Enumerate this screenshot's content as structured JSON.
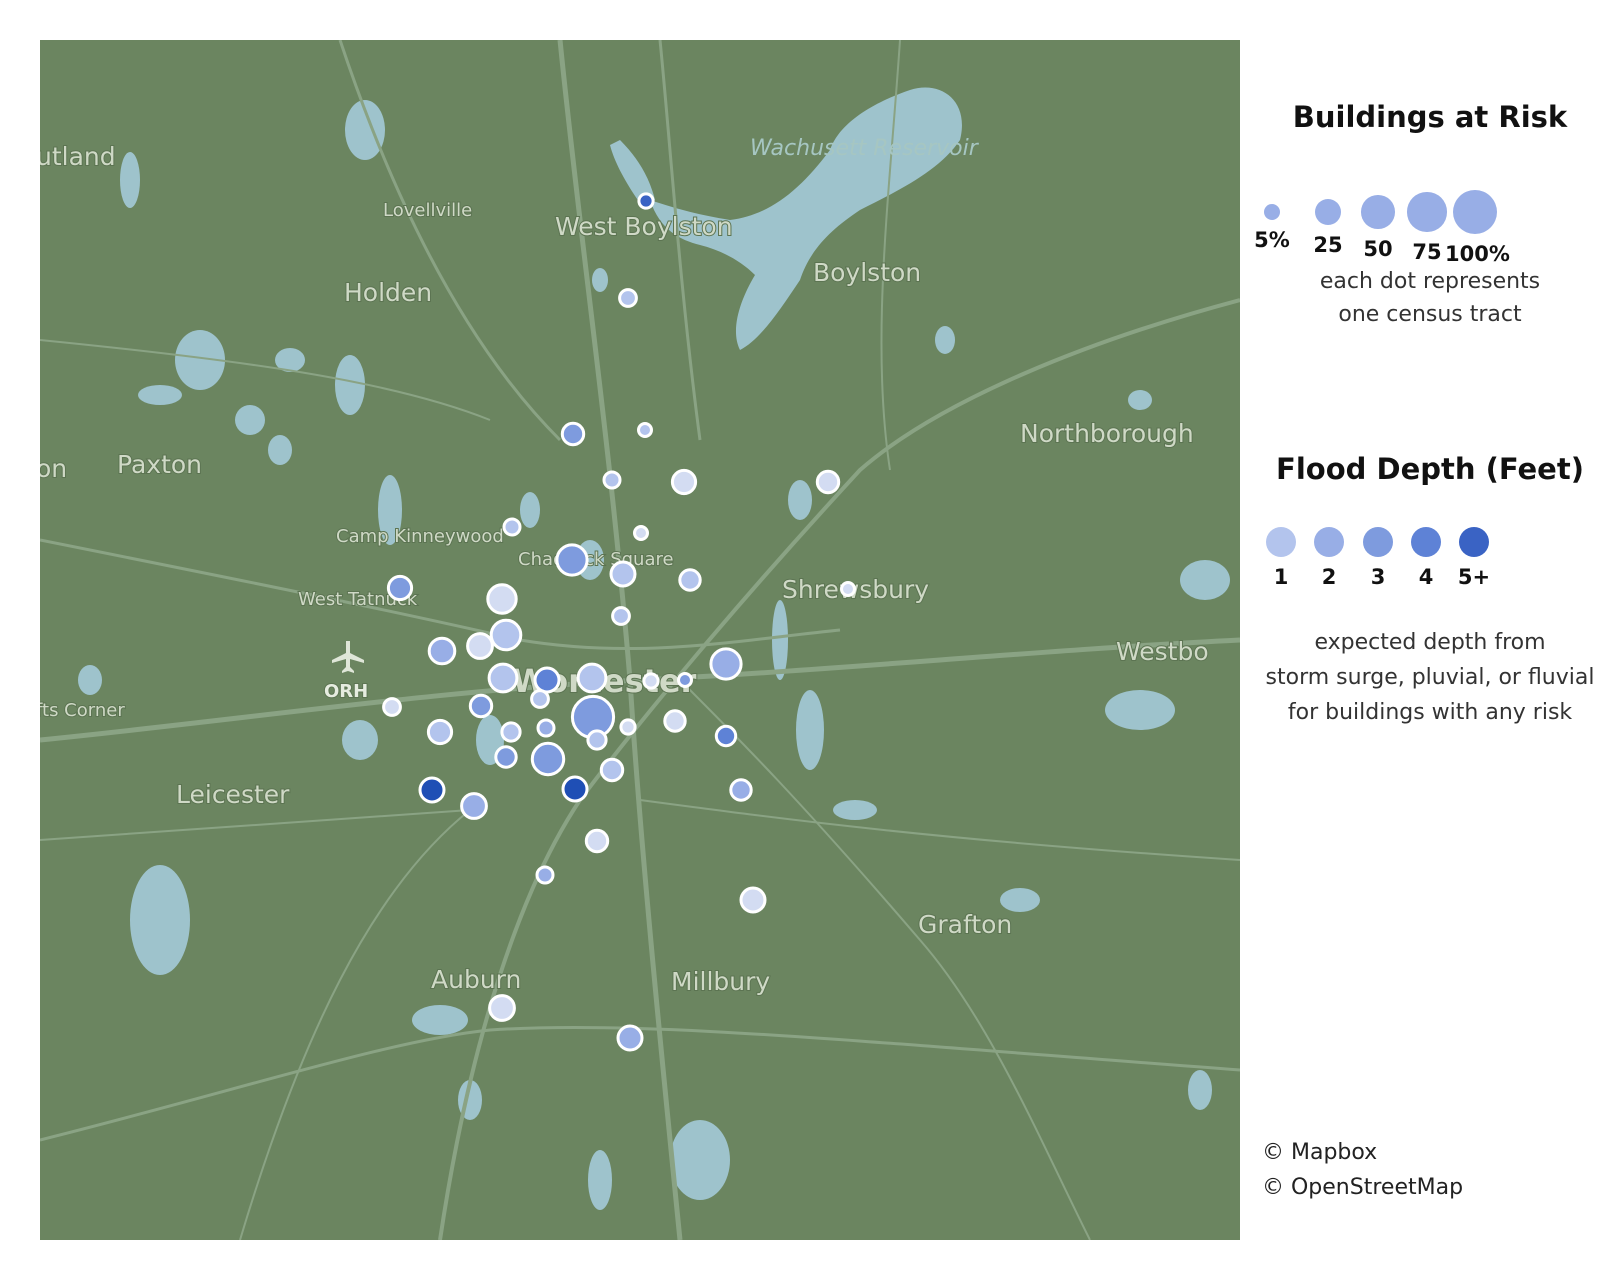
{
  "map": {
    "places": [
      {
        "name": "Rutland",
        "display": "utland",
        "size": "lg"
      },
      {
        "name": "Lovellville",
        "size": "sm"
      },
      {
        "name": "West Boylston",
        "size": "lg"
      },
      {
        "name": "Holden",
        "size": "lg"
      },
      {
        "name": "Boylston",
        "size": "lg"
      },
      {
        "name": "Paxton",
        "size": "lg"
      },
      {
        "name": "Northborough",
        "size": "lg"
      },
      {
        "name": "Camp Kinneywood",
        "size": "sm"
      },
      {
        "name": "Chadwick Square",
        "size": "sm"
      },
      {
        "name": "West Tatnuck",
        "size": "sm"
      },
      {
        "name": "Shrewsbury",
        "size": "lg"
      },
      {
        "name": "Westborough",
        "display": "Westbo",
        "size": "lg"
      },
      {
        "name": "ORH",
        "size": "airport"
      },
      {
        "name": "Worcester",
        "size": "city"
      },
      {
        "name": "Tufts Corner",
        "display": "fts Corner",
        "size": "sm"
      },
      {
        "name": "Leicester",
        "size": "lg"
      },
      {
        "name": "Grafton",
        "size": "lg"
      },
      {
        "name": "Auburn",
        "size": "lg"
      },
      {
        "name": "Millbury",
        "size": "lg"
      },
      {
        "name": "Spencer",
        "display": "on",
        "size": "lg"
      }
    ],
    "water_label": "Wachusett Reservoir",
    "colors": {
      "land": "#6b8560",
      "water": "#9ec3cc",
      "roads": "#8aa384",
      "dot_outline": "#ffffff",
      "depth_1": "#b3c4ed",
      "depth_2": "#98aee6",
      "depth_3": "#7e9bde",
      "depth_4": "#5e82d6",
      "depth_5_plus": "#3a63c4"
    },
    "tracts": [
      {
        "risk_pct": 3,
        "depth": 5
      },
      {
        "risk_pct": 6,
        "depth": 1
      },
      {
        "risk_pct": 14,
        "depth": 3
      },
      {
        "risk_pct": 2,
        "depth": 1
      },
      {
        "risk_pct": 5,
        "depth": 1
      },
      {
        "risk_pct": 18,
        "depth": 0
      },
      {
        "risk_pct": 14,
        "depth": 0
      },
      {
        "risk_pct": 5,
        "depth": 1
      },
      {
        "risk_pct": 2,
        "depth": 0
      },
      {
        "risk_pct": 38,
        "depth": 3
      },
      {
        "risk_pct": 20,
        "depth": 1
      },
      {
        "risk_pct": 12,
        "depth": 1
      },
      {
        "risk_pct": 2,
        "depth": 0
      },
      {
        "risk_pct": 18,
        "depth": 3
      },
      {
        "risk_pct": 32,
        "depth": 0
      },
      {
        "risk_pct": 6,
        "depth": 1
      },
      {
        "risk_pct": 36,
        "depth": 1
      },
      {
        "risk_pct": 22,
        "depth": 0
      },
      {
        "risk_pct": 24,
        "depth": 2
      },
      {
        "risk_pct": 38,
        "depth": 2
      },
      {
        "risk_pct": 30,
        "depth": 1
      },
      {
        "risk_pct": 30,
        "depth": 1
      },
      {
        "risk_pct": 3,
        "depth": 0
      },
      {
        "risk_pct": 2,
        "depth": 3
      },
      {
        "risk_pct": 20,
        "depth": 4
      },
      {
        "risk_pct": 6,
        "depth": 0
      },
      {
        "risk_pct": 14,
        "depth": 3
      },
      {
        "risk_pct": 6,
        "depth": 1
      },
      {
        "risk_pct": 85,
        "depth": 3
      },
      {
        "risk_pct": 3,
        "depth": 0
      },
      {
        "risk_pct": 8,
        "depth": 1
      },
      {
        "risk_pct": 18,
        "depth": 1
      },
      {
        "risk_pct": 5,
        "depth": 2
      },
      {
        "risk_pct": 12,
        "depth": 0
      },
      {
        "risk_pct": 42,
        "depth": 3
      },
      {
        "risk_pct": 12,
        "depth": 3
      },
      {
        "risk_pct": 8,
        "depth": 1
      },
      {
        "risk_pct": 10,
        "depth": 4
      },
      {
        "risk_pct": 20,
        "depth": 6
      },
      {
        "risk_pct": 20,
        "depth": 6
      },
      {
        "risk_pct": 22,
        "depth": 2
      },
      {
        "risk_pct": 14,
        "depth": 1
      },
      {
        "risk_pct": 12,
        "depth": 2
      },
      {
        "risk_pct": 14,
        "depth": 0
      },
      {
        "risk_pct": 5,
        "depth": 2
      },
      {
        "risk_pct": 20,
        "depth": 0
      },
      {
        "risk_pct": 22,
        "depth": 0
      },
      {
        "risk_pct": 20,
        "depth": 2
      }
    ]
  },
  "legend": {
    "size_title": "Buildings at Risk",
    "size_items": [
      {
        "label": "5%",
        "pct": 5
      },
      {
        "label": "25",
        "pct": 25
      },
      {
        "label": "50",
        "pct": 50
      },
      {
        "label": "75",
        "pct": 75
      },
      {
        "label": "100%",
        "pct": 100
      }
    ],
    "size_note_1": "each dot represents",
    "size_note_2": "one census tract",
    "depth_title": "Flood Depth (Feet)",
    "depth_items": [
      {
        "label": "1",
        "color": "#b3c4ed"
      },
      {
        "label": "2",
        "color": "#98aee6"
      },
      {
        "label": "3",
        "color": "#7e9bde"
      },
      {
        "label": "4",
        "color": "#5e82d6"
      },
      {
        "label": "5+",
        "color": "#3a63c4"
      }
    ],
    "depth_note_1": "expected depth from",
    "depth_note_2": "storm surge, pluvial, or fluvial",
    "depth_note_3": "for buildings with any risk"
  },
  "attribution": {
    "mapbox": "© Mapbox",
    "osm": "© OpenStreetMap"
  }
}
